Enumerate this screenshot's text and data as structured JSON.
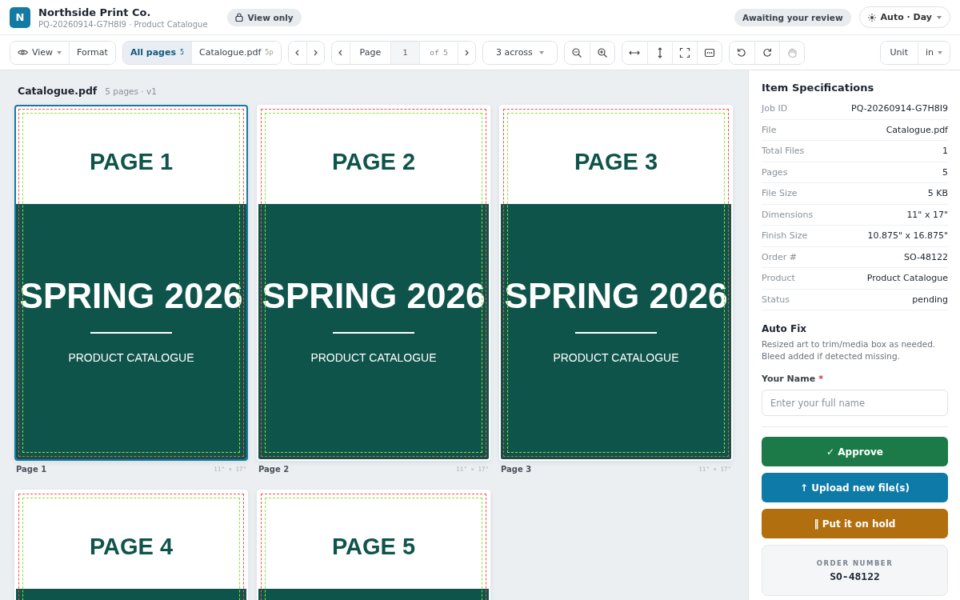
{
  "header": {
    "logo_letter": "N",
    "company": "Northside Print Co.",
    "subtitle": "PQ-20260914-G7H8I9 · Product Catalogue",
    "access_badge": "View only",
    "status_badge": "Awaiting your review",
    "theme_menu": "Auto · Day"
  },
  "toolbar": {
    "view_menu": "View",
    "format_button": "Format",
    "file_tabs": [
      {
        "label": "All pages",
        "count": "5",
        "selected": true
      },
      {
        "label": "Catalogue.pdf",
        "count": "5p",
        "selected": false
      }
    ],
    "page_label": "Page",
    "page_value": "1",
    "page_total": "of 5",
    "layout_menu": "3 across",
    "tool_groups": [
      [
        {
          "kind": "zoom-out",
          "disabled": false
        },
        {
          "kind": "zoom-in",
          "disabled": false
        }
      ],
      [
        {
          "kind": "fit-width",
          "disabled": false
        },
        {
          "kind": "fit-height",
          "disabled": false
        },
        {
          "kind": "fullscreen",
          "disabled": false
        },
        {
          "kind": "display",
          "disabled": false
        }
      ],
      [
        {
          "kind": "rotate-left",
          "disabled": false
        },
        {
          "kind": "rotate-right",
          "disabled": false
        },
        {
          "kind": "pan",
          "disabled": true
        }
      ]
    ],
    "unit_label": "Unit",
    "unit_value": "in"
  },
  "document": {
    "name": "Catalogue.pdf",
    "meta": "5 pages · v1",
    "pages": [
      {
        "title": "PAGE 1",
        "headline": "SPRING 2026",
        "subtitle": "PRODUCT CATALOGUE",
        "caption": "Page 1",
        "size": "11\" × 17\"",
        "selected": true
      },
      {
        "title": "PAGE 2",
        "headline": "SPRING 2026",
        "subtitle": "PRODUCT CATALOGUE",
        "caption": "Page 2",
        "size": "11\" × 17\"",
        "selected": false
      },
      {
        "title": "PAGE 3",
        "headline": "SPRING 2026",
        "subtitle": "PRODUCT CATALOGUE",
        "caption": "Page 3",
        "size": "11\" × 17\"",
        "selected": false
      },
      {
        "title": "PAGE 4",
        "selected": false
      },
      {
        "title": "PAGE 5",
        "selected": false
      }
    ]
  },
  "sidebar": {
    "title": "Item Specifications",
    "specs": [
      {
        "label": "Job ID",
        "value": "PQ-20260914-G7H8I9"
      },
      {
        "label": "File",
        "value": "Catalogue.pdf"
      },
      {
        "label": "Total Files",
        "value": "1"
      },
      {
        "label": "Pages",
        "value": "5"
      },
      {
        "label": "File Size",
        "value": "5 KB"
      },
      {
        "label": "Dimensions",
        "value": "11\" x 17\""
      },
      {
        "label": "Finish Size",
        "value": "10.875\" x 16.875\""
      },
      {
        "label": "Order #",
        "value": "SO-48122"
      },
      {
        "label": "Product",
        "value": "Product Catalogue"
      },
      {
        "label": "Status",
        "value": "pending"
      }
    ],
    "auto_fix": {
      "title": "Auto Fix",
      "text": "Resized art to trim/media box as needed. Bleed added if detected missing."
    },
    "name_field": {
      "label": "Your Name",
      "required_mark": "*",
      "placeholder": "Enter your full name"
    },
    "actions": [
      {
        "kind": "approve",
        "label": "✓ Approve"
      },
      {
        "kind": "upload",
        "label": "↑ Upload new file(s)"
      },
      {
        "kind": "hold",
        "label": "‖ Put it on hold"
      }
    ],
    "order_box": {
      "label": "ORDER NUMBER",
      "value": "SO-48122"
    }
  }
}
